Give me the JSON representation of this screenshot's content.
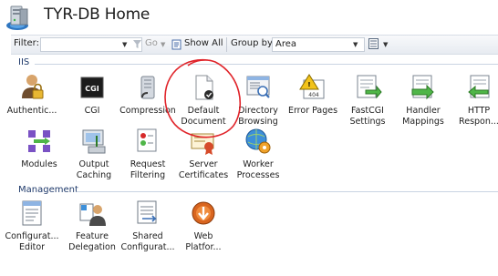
{
  "header": {
    "title": "TYR-DB Home"
  },
  "toolbar": {
    "filter_label": "Filter:",
    "go_label": "Go",
    "show_all_label": "Show All",
    "group_by_label": "Group by:",
    "group_by_value": "Area"
  },
  "sections": [
    {
      "label": "IIS",
      "features": [
        {
          "label": "Authentic...",
          "icon": "authentication-icon"
        },
        {
          "label": "CGI",
          "icon": "cgi-icon"
        },
        {
          "label": "Compression",
          "icon": "compression-icon"
        },
        {
          "label": "Default\nDocument",
          "icon": "default-document-icon"
        },
        {
          "label": "Directory\nBrowsing",
          "icon": "directory-browsing-icon"
        },
        {
          "label": "Error Pages",
          "icon": "error-pages-icon"
        },
        {
          "label": "FastCGI\nSettings",
          "icon": "fastcgi-settings-icon"
        },
        {
          "label": "Handler\nMappings",
          "icon": "handler-mappings-icon"
        },
        {
          "label": "HTTP\nRespon...",
          "icon": "http-response-icon"
        },
        {
          "label": "Modules",
          "icon": "modules-icon"
        },
        {
          "label": "Output\nCaching",
          "icon": "output-caching-icon"
        },
        {
          "label": "Request\nFiltering",
          "icon": "request-filtering-icon"
        },
        {
          "label": "Server\nCertificates",
          "icon": "server-certificates-icon"
        },
        {
          "label": "Worker\nProcesses",
          "icon": "worker-processes-icon"
        }
      ]
    },
    {
      "label": "Management",
      "features": [
        {
          "label": "Configurat...\nEditor",
          "icon": "configuration-editor-icon"
        },
        {
          "label": "Feature\nDelegation",
          "icon": "feature-delegation-icon"
        },
        {
          "label": "Shared\nConfigurat...",
          "icon": "shared-configuration-icon"
        },
        {
          "label": "Web\nPlatfor...",
          "icon": "web-platform-icon"
        }
      ]
    }
  ],
  "error_icon_text": "404",
  "cgi_icon_text": "CGI",
  "colors": {
    "annotation": "#e0242a",
    "section_title": "#1f3a6b",
    "toolbar_bg": "#e7ebf1"
  }
}
